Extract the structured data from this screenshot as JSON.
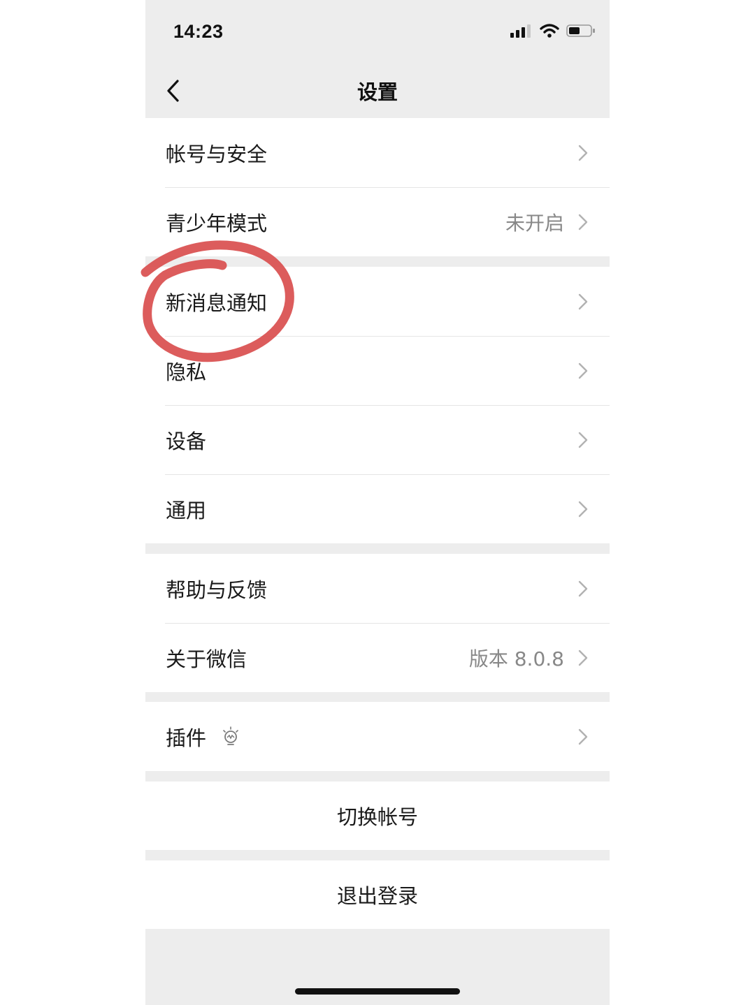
{
  "status_bar": {
    "time": "14:23",
    "icons": [
      "signal-icon",
      "wifi-icon",
      "battery-icon"
    ]
  },
  "nav": {
    "title": "设置",
    "back_icon": "chevron-left-icon"
  },
  "groups": [
    {
      "items": [
        {
          "label": "帐号与安全",
          "value": ""
        },
        {
          "label": "青少年模式",
          "value": "未开启"
        }
      ]
    },
    {
      "items": [
        {
          "label": "新消息通知",
          "value": ""
        },
        {
          "label": "隐私",
          "value": ""
        },
        {
          "label": "设备",
          "value": ""
        },
        {
          "label": "通用",
          "value": ""
        }
      ]
    },
    {
      "items": [
        {
          "label": "帮助与反馈",
          "value": ""
        },
        {
          "label": "关于微信",
          "value": "版本 8.0.8"
        }
      ]
    },
    {
      "items": [
        {
          "label": "插件",
          "value": "",
          "icon": "lightbulb-icon"
        }
      ]
    }
  ],
  "actions": {
    "switch_account": "切换帐号",
    "logout": "退出登录"
  },
  "colors": {
    "background": "#ededed",
    "cell": "#ffffff",
    "annotation_circle": "#d84a4a"
  }
}
